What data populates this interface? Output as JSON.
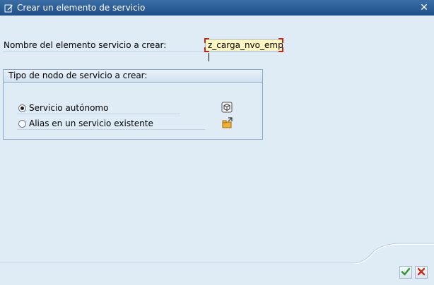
{
  "window": {
    "title": "Crear un elemento de servicio",
    "title_icon": "document-edit-icon",
    "close_label": "✕"
  },
  "form": {
    "name_label": "Nombre del elemento servicio a crear:",
    "name_value": "z_carga_nvo_emp"
  },
  "group": {
    "title": "Tipo de nodo de servicio a crear:",
    "options": [
      {
        "label": "Servicio autónomo",
        "selected": true,
        "icon": "service-cube-icon"
      },
      {
        "label": "Alias en un servicio existente",
        "selected": false,
        "icon": "alias-folder-icon"
      }
    ]
  },
  "footer": {
    "ok_icon": "checkmark-icon",
    "cancel_icon": "cancel-x-icon"
  },
  "colors": {
    "background": "#dfebf5",
    "titlebar": "#1f4f8a",
    "input_background": "#fff7c0",
    "ok_green": "#2e9a2e",
    "cancel_red": "#c8301c"
  }
}
